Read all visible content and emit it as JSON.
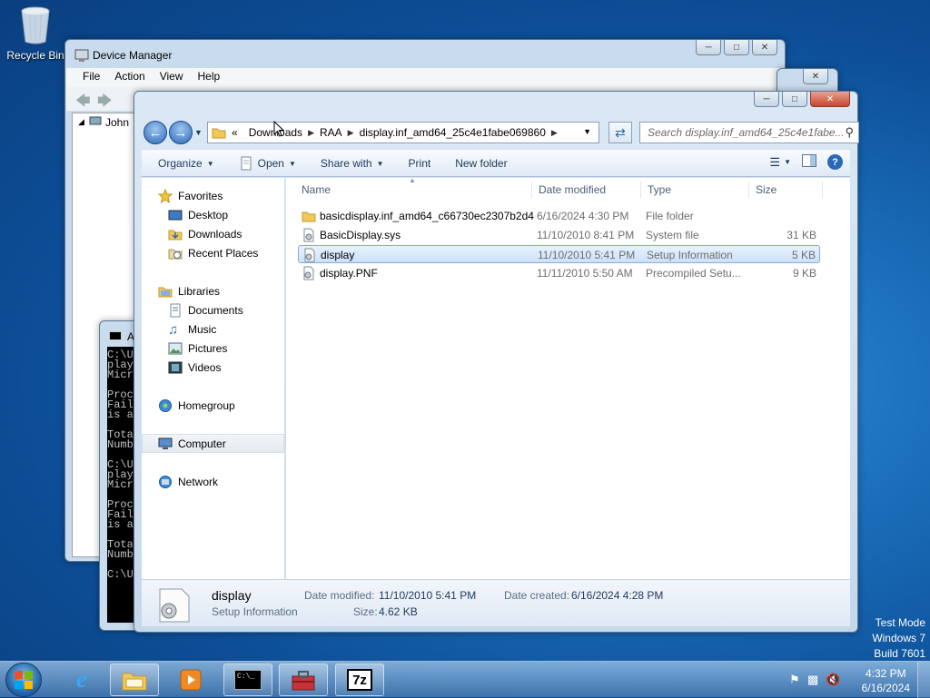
{
  "desktop": {
    "recycle_bin_label": "Recycle Bin",
    "watermark": [
      "Test Mode",
      "Windows 7",
      "Build 7601"
    ]
  },
  "device_manager": {
    "title": "Device Manager",
    "menu": [
      "File",
      "Action",
      "View",
      "Help"
    ],
    "tree_root": "John"
  },
  "cmd": {
    "title": "A",
    "lines": [
      "C:\\U",
      "play",
      "Micr",
      "",
      "Proc",
      "Fail",
      "is a",
      "",
      "Tota",
      "Numb",
      "",
      "C:\\U",
      "play",
      "Micr",
      "",
      "Proc",
      "Fail",
      "is a",
      "",
      "Tota",
      "Numb",
      "",
      "C:\\U"
    ]
  },
  "explorer": {
    "address": {
      "overflow": "«",
      "segments": [
        "Downloads",
        "RAA",
        "display.inf_amd64_25c4e1fabe069860"
      ]
    },
    "search_placeholder": "Search display.inf_amd64_25c4e1fabe...",
    "commands": {
      "organize": "Organize",
      "open": "Open",
      "share_with": "Share with",
      "print": "Print",
      "new_folder": "New folder"
    },
    "nav": {
      "favorites": "Favorites",
      "desktop": "Desktop",
      "downloads": "Downloads",
      "recent_places": "Recent Places",
      "libraries": "Libraries",
      "documents": "Documents",
      "music": "Music",
      "pictures": "Pictures",
      "videos": "Videos",
      "homegroup": "Homegroup",
      "computer": "Computer",
      "network": "Network"
    },
    "columns": {
      "name": "Name",
      "date_modified": "Date modified",
      "type": "Type",
      "size": "Size"
    },
    "files": [
      {
        "name": "basicdisplay.inf_amd64_c66730ec2307b2d4",
        "date": "6/16/2024 4:30 PM",
        "type": "File folder",
        "size": "",
        "icon": "folder-icon"
      },
      {
        "name": "BasicDisplay.sys",
        "date": "11/10/2010 8:41 PM",
        "type": "System file",
        "size": "31 KB",
        "icon": "system-file-icon"
      },
      {
        "name": "display",
        "date": "11/10/2010 5:41 PM",
        "type": "Setup Information",
        "size": "5 KB",
        "icon": "setup-info-icon"
      },
      {
        "name": "display.PNF",
        "date": "11/11/2010 5:50 AM",
        "type": "Precompiled Setu...",
        "size": "9 KB",
        "icon": "pnf-file-icon"
      }
    ],
    "details": {
      "name": "display",
      "type": "Setup Information",
      "date_modified_label": "Date modified:",
      "date_modified": "11/10/2010 5:41 PM",
      "size_label": "Size:",
      "size": "4.62 KB",
      "date_created_label": "Date created:",
      "date_created": "6/16/2024 4:28 PM"
    }
  },
  "taskbar": {
    "time": "4:32 PM",
    "date": "6/16/2024",
    "cmd_glyph": "C:\\_",
    "sevenzip_glyph": "7z"
  },
  "colors": {
    "selection": "#cce2fa",
    "link_blue": "#1e395b",
    "wallpaper": "#1a6cb8"
  }
}
